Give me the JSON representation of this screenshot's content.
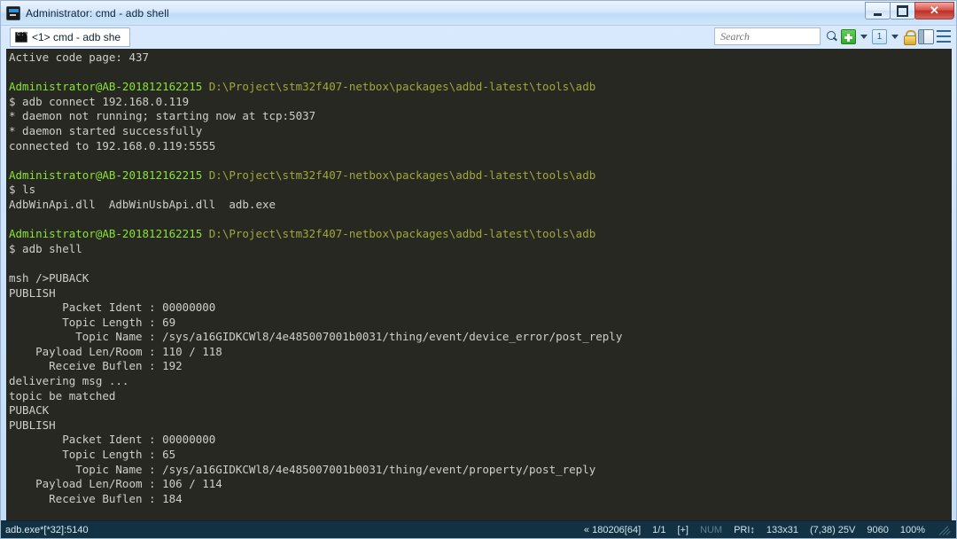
{
  "window": {
    "title": "Administrator: cmd - adb  shell",
    "icon": "console-icon",
    "minimize_label": "",
    "maximize_label": "",
    "close_label": "✕"
  },
  "tabbar": {
    "tab_label": "<1> cmd - adb  she",
    "tab_icon": "console-icon"
  },
  "toolbar": {
    "search_placeholder": "Search",
    "search_value": "",
    "icons": [
      "new-console-icon",
      "new-console-dropdown-icon",
      "switch-console-icon",
      "switch-console-dropdown-icon",
      "admin-lock-icon",
      "toggle-panel-icon",
      "menu-icon"
    ],
    "switch_console_label": "1"
  },
  "console": {
    "background": "#272822",
    "prompt_user_color": "#8ae234",
    "prompt_path_color": "#9fa83a",
    "text_color": "#cfcfc7",
    "lines": [
      {
        "type": "plain",
        "text": "Active code page: 437"
      },
      {
        "type": "blank",
        "text": ""
      },
      {
        "type": "prompt",
        "user": "Administrator@AB-201812162215",
        "path": "D:\\Project\\stm32f407-netbox\\packages\\adbd-latest\\tools\\adb"
      },
      {
        "type": "plain",
        "text": "$ adb connect 192.168.0.119"
      },
      {
        "type": "plain",
        "text": "* daemon not running; starting now at tcp:5037"
      },
      {
        "type": "plain",
        "text": "* daemon started successfully"
      },
      {
        "type": "plain",
        "text": "connected to 192.168.0.119:5555"
      },
      {
        "type": "blank",
        "text": ""
      },
      {
        "type": "prompt",
        "user": "Administrator@AB-201812162215",
        "path": "D:\\Project\\stm32f407-netbox\\packages\\adbd-latest\\tools\\adb"
      },
      {
        "type": "plain",
        "text": "$ ls"
      },
      {
        "type": "plain",
        "text": "AdbWinApi.dll  AdbWinUsbApi.dll  adb.exe"
      },
      {
        "type": "blank",
        "text": ""
      },
      {
        "type": "prompt",
        "user": "Administrator@AB-201812162215",
        "path": "D:\\Project\\stm32f407-netbox\\packages\\adbd-latest\\tools\\adb"
      },
      {
        "type": "plain",
        "text": "$ adb shell"
      },
      {
        "type": "blank",
        "text": ""
      },
      {
        "type": "plain",
        "text": "msh />PUBACK"
      },
      {
        "type": "plain",
        "text": "PUBLISH"
      },
      {
        "type": "plain",
        "text": "        Packet Ident : 00000000"
      },
      {
        "type": "plain",
        "text": "        Topic Length : 69"
      },
      {
        "type": "plain",
        "text": "          Topic Name : /sys/a16GIDKCWl8/4e485007001b0031/thing/event/device_error/post_reply"
      },
      {
        "type": "plain",
        "text": "    Payload Len/Room : 110 / 118"
      },
      {
        "type": "plain",
        "text": "      Receive Buflen : 192"
      },
      {
        "type": "plain",
        "text": "delivering msg ..."
      },
      {
        "type": "plain",
        "text": "topic be matched"
      },
      {
        "type": "plain",
        "text": "PUBACK"
      },
      {
        "type": "plain",
        "text": "PUBLISH"
      },
      {
        "type": "plain",
        "text": "        Packet Ident : 00000000"
      },
      {
        "type": "plain",
        "text": "        Topic Length : 65"
      },
      {
        "type": "plain",
        "text": "          Topic Name : /sys/a16GIDKCWl8/4e485007001b0031/thing/event/property/post_reply"
      },
      {
        "type": "plain",
        "text": "    Payload Len/Room : 106 / 114"
      },
      {
        "type": "plain",
        "text": "      Receive Buflen : 184"
      }
    ]
  },
  "statusbar": {
    "process": "adb.exe*[*32]:5140",
    "build": "« 180206[64]",
    "tabs": "1/1",
    "selection": "[+]",
    "num_lock": "NUM",
    "priority": "PRI↕",
    "size": "133x31",
    "cursor": "(7,38) 25V",
    "scrollback": "9060",
    "zoom": "100%",
    "grip": "resize-grip-icon"
  }
}
